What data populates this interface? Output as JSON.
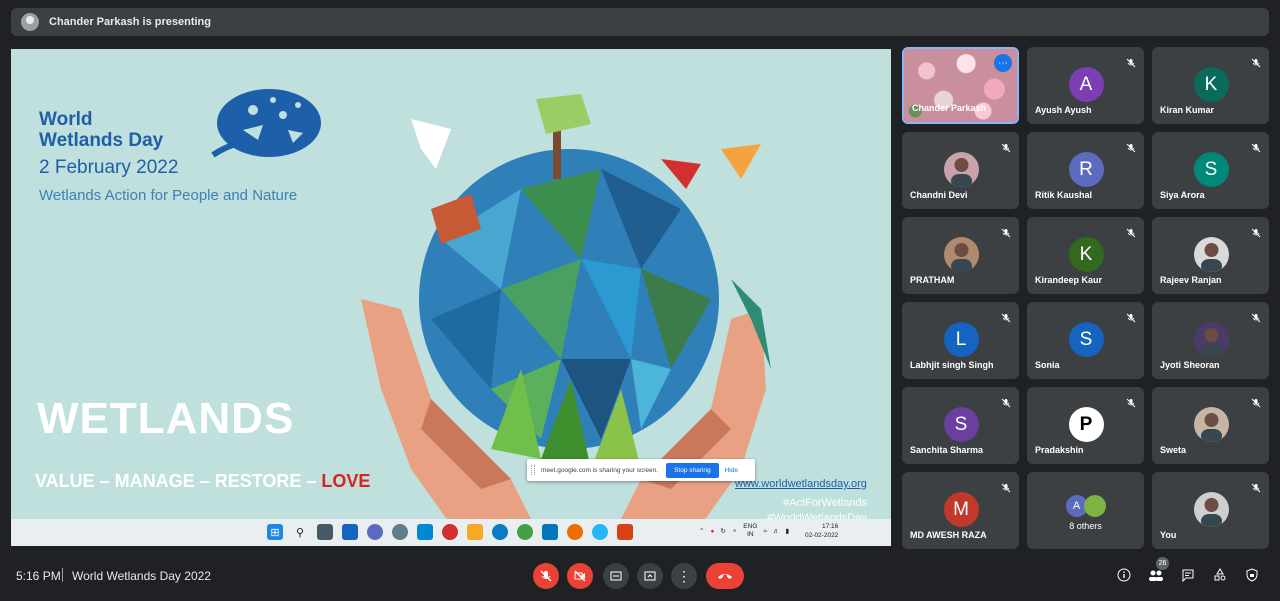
{
  "presenter_bar": {
    "text": "Chander Parkash is presenting"
  },
  "slide": {
    "title_line1": "World",
    "title_line2": "Wetlands Day",
    "date": "2 February 2022",
    "subtitle": "Wetlands Action for People and Nature",
    "headline": "WETLANDS",
    "tagline_main": "VALUE – MANAGE – RESTORE – ",
    "tagline_love": "LOVE",
    "url": "www.worldwetlandsday.org",
    "hashtag1": "#ActForWetlands",
    "hashtag2": "#WorldWetlandsDay"
  },
  "share_banner": {
    "message": "meet.google.com is sharing your screen.",
    "stop_label": "Stop sharing",
    "hide_label": "Hide"
  },
  "taskbar": {
    "lang_line1": "ENG",
    "lang_line2": "IN",
    "clock_time": "17:16",
    "clock_date": "02-02-2022"
  },
  "participants": [
    {
      "name": "Chander Parkash",
      "type": "video-flowers",
      "muted": false,
      "active": true
    },
    {
      "name": "Ayush Ayush",
      "initial": "A",
      "color": "#7b3fb3",
      "muted": true
    },
    {
      "name": "Kiran Kumar",
      "initial": "K",
      "color": "#0b6b5a",
      "muted": true
    },
    {
      "name": "Chandni Devi",
      "type": "photo",
      "color": "#c9a2ab",
      "muted": true
    },
    {
      "name": "Ritik Kaushal",
      "initial": "R",
      "color": "#5c6bc0",
      "muted": true
    },
    {
      "name": "Siya Arora",
      "initial": "S",
      "color": "#00897b",
      "muted": true
    },
    {
      "name": "PRATHAM",
      "type": "photo",
      "color": "#b08a6e",
      "muted": true
    },
    {
      "name": "Kirandeep Kaur",
      "initial": "K",
      "color": "#33691e",
      "muted": true
    },
    {
      "name": "Rajeev Ranjan",
      "type": "photo",
      "color": "#d9d9d9",
      "muted": true
    },
    {
      "name": "Labhjit singh Singh",
      "initial": "L",
      "color": "#1565c0",
      "muted": true
    },
    {
      "name": "Sonia",
      "initial": "S",
      "color": "#1565c0",
      "muted": true
    },
    {
      "name": "Jyoti Sheoran",
      "type": "photo",
      "color": "#4a3b6b",
      "muted": true
    },
    {
      "name": "Sanchita Sharma",
      "initial": "S",
      "color": "#6a3fa0",
      "muted": true
    },
    {
      "name": "Pradakshin",
      "initial": "P",
      "color": "#ffffff",
      "text_color": "#000000",
      "muted": true
    },
    {
      "name": "Sweta",
      "type": "photo",
      "color": "#c5b5a3",
      "muted": true
    },
    {
      "name": "MD AWESH RAZA",
      "initial": "M",
      "color": "#c0392b",
      "muted": true
    },
    {
      "name": "8 others",
      "type": "others",
      "initial": "A",
      "color": "#5c6bc0",
      "muted": false
    },
    {
      "name": "You",
      "type": "photo",
      "color": "#cfcfcf",
      "muted": true
    }
  ],
  "bottom": {
    "time": "5:16 PM",
    "meeting_name": "World Wetlands Day 2022",
    "people_count": "26"
  },
  "colors": {
    "bg": "#202124",
    "tile": "#3c4043",
    "danger": "#ea4335",
    "accent": "#1a73e8"
  }
}
